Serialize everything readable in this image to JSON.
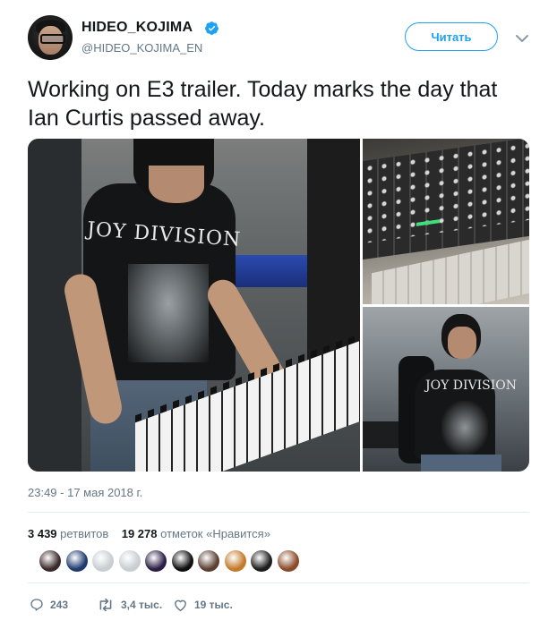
{
  "author": {
    "display_name": "HIDEO_KOJIMA",
    "handle": "@HIDEO_KOJIMA_EN",
    "verified_icon": "verified-badge-icon"
  },
  "follow_button": {
    "label": "Читать"
  },
  "tweet": {
    "text": "Working on E3 trailer. Today marks the day that Ian Curtis passed away.",
    "timestamp": "23:49 - 17 мая 2018 г."
  },
  "media": {
    "shirt_text_main": "JOY DIVISION",
    "shirt_text_side": "JOY DIVISION"
  },
  "stats": {
    "retweets_count": "3 439",
    "retweets_label": "ретвитов",
    "likes_count": "19 278",
    "likes_label": "отметок «Нравится»"
  },
  "likers": [
    {
      "color": "#3b2a2a"
    },
    {
      "color": "#1f3b6e"
    },
    {
      "color": "#c8cdd2"
    },
    {
      "color": "#c8cdd2"
    },
    {
      "color": "#2b1e45"
    },
    {
      "color": "#0f0f0f"
    },
    {
      "color": "#5a4033"
    },
    {
      "color": "#c47a2b"
    },
    {
      "color": "#1e1e1e"
    },
    {
      "color": "#8a4b2a"
    }
  ],
  "actions": {
    "replies": "243",
    "retweets": "3,4 тыс.",
    "likes": "19 тыс."
  },
  "colors": {
    "accent": "#1da1f2",
    "muted": "#657786"
  }
}
